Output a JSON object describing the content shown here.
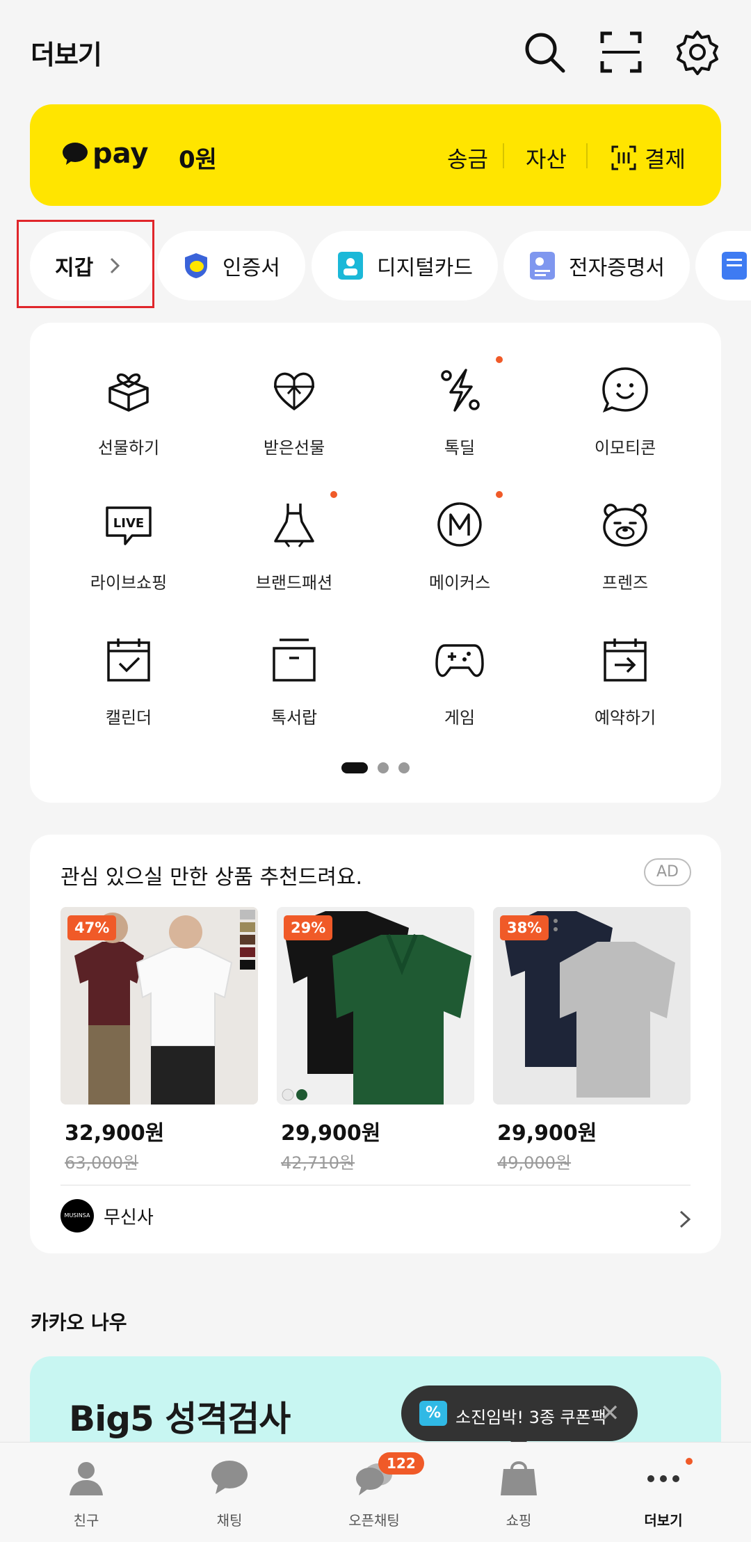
{
  "header": {
    "title": "더보기"
  },
  "pay": {
    "logo": "pay",
    "balance": "0원",
    "actions": [
      "송금",
      "자산",
      "결제"
    ]
  },
  "chips": [
    {
      "label": "지갑"
    },
    {
      "label": "인증서"
    },
    {
      "label": "디지털카드"
    },
    {
      "label": "전자증명서"
    }
  ],
  "grid": [
    {
      "label": "선물하기",
      "icon": "gift-box-icon"
    },
    {
      "label": "받은선물",
      "icon": "heart-gift-icon"
    },
    {
      "label": "톡딜",
      "icon": "percent-bolt-icon",
      "dot": true
    },
    {
      "label": "이모티콘",
      "icon": "smile-icon"
    },
    {
      "label": "라이브쇼핑",
      "icon": "live-icon"
    },
    {
      "label": "브랜드패션",
      "icon": "dress-icon",
      "dot": true
    },
    {
      "label": "메이커스",
      "icon": "makers-m-icon",
      "dot": true
    },
    {
      "label": "프렌즈",
      "icon": "bear-icon"
    },
    {
      "label": "캘린더",
      "icon": "calendar-check-icon"
    },
    {
      "label": "톡서랍",
      "icon": "drawer-icon"
    },
    {
      "label": "게임",
      "icon": "gamepad-icon"
    },
    {
      "label": "예약하기",
      "icon": "calendar-arrow-icon"
    }
  ],
  "ad": {
    "title": "관심 있으실 만한 상품 추천드려요.",
    "badge": "AD",
    "products": [
      {
        "discount": "47%",
        "price": "32,900원",
        "original": "63,000원"
      },
      {
        "discount": "29%",
        "price": "29,900원",
        "original": "42,710원"
      },
      {
        "discount": "38%",
        "price": "29,900원",
        "original": "49,000원"
      }
    ],
    "brand_logo": "MUSINSA",
    "brand_name": "무신사"
  },
  "now": {
    "title": "카카오 나우",
    "banner_title": "Big5 성격검사"
  },
  "toast": {
    "tag": "%",
    "text": "소진임박! 3종 쿠폰팩"
  },
  "tabs": [
    {
      "label": "친구"
    },
    {
      "label": "채팅"
    },
    {
      "label": "오픈채팅",
      "badge": "122"
    },
    {
      "label": "쇼핑"
    },
    {
      "label": "더보기"
    }
  ],
  "colors": {
    "pay_yellow": "#ffe500",
    "badge_orange": "#f05a28",
    "banner_bg": "#c8f6f2",
    "highlight_red": "#e0262b"
  }
}
